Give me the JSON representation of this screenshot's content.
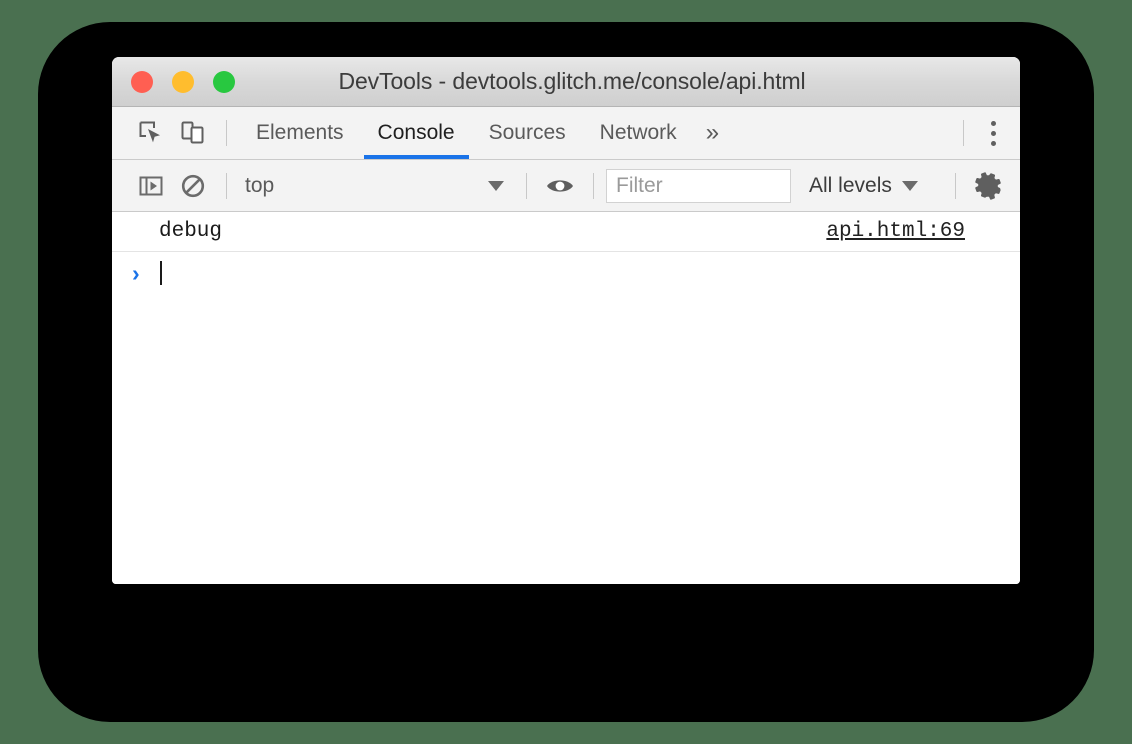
{
  "window": {
    "title": "DevTools - devtools.glitch.me/console/api.html",
    "traffic_lights": [
      {
        "name": "close",
        "color": "#ff5f52"
      },
      {
        "name": "minimize",
        "color": "#ffbd2e"
      },
      {
        "name": "maximize",
        "color": "#28c840"
      }
    ]
  },
  "tabbar": {
    "inspect_icon": "inspect-element-icon",
    "device_icon": "device-toolbar-icon",
    "tabs": [
      {
        "label": "Elements",
        "active": false
      },
      {
        "label": "Console",
        "active": true
      },
      {
        "label": "Sources",
        "active": false
      },
      {
        "label": "Network",
        "active": false
      }
    ],
    "more_tabs_label": "»",
    "menu_icon": "vertical-dots-icon",
    "active_tab_color": "#1a73e8"
  },
  "console_toolbar": {
    "sidebar_toggle_icon": "console-sidebar-icon",
    "clear_console_icon": "clear-console-icon",
    "context": {
      "value": "top",
      "caret": "chevron-down-icon"
    },
    "eye_icon": "live-expression-eye-icon",
    "filter": {
      "value": "",
      "placeholder": "Filter"
    },
    "levels": {
      "value": "All levels",
      "caret": "chevron-down-icon"
    },
    "settings_icon": "gear-icon"
  },
  "console": {
    "messages": [
      {
        "text": "debug",
        "source": "api.html:69",
        "level": "debug"
      }
    ],
    "prompt": {
      "chevron": "›",
      "input_value": ""
    }
  },
  "colors": {
    "backdrop": "#4a7050",
    "plate": "#000000",
    "accent": "#1a73e8",
    "toolbar_bg": "#f3f3f3"
  }
}
